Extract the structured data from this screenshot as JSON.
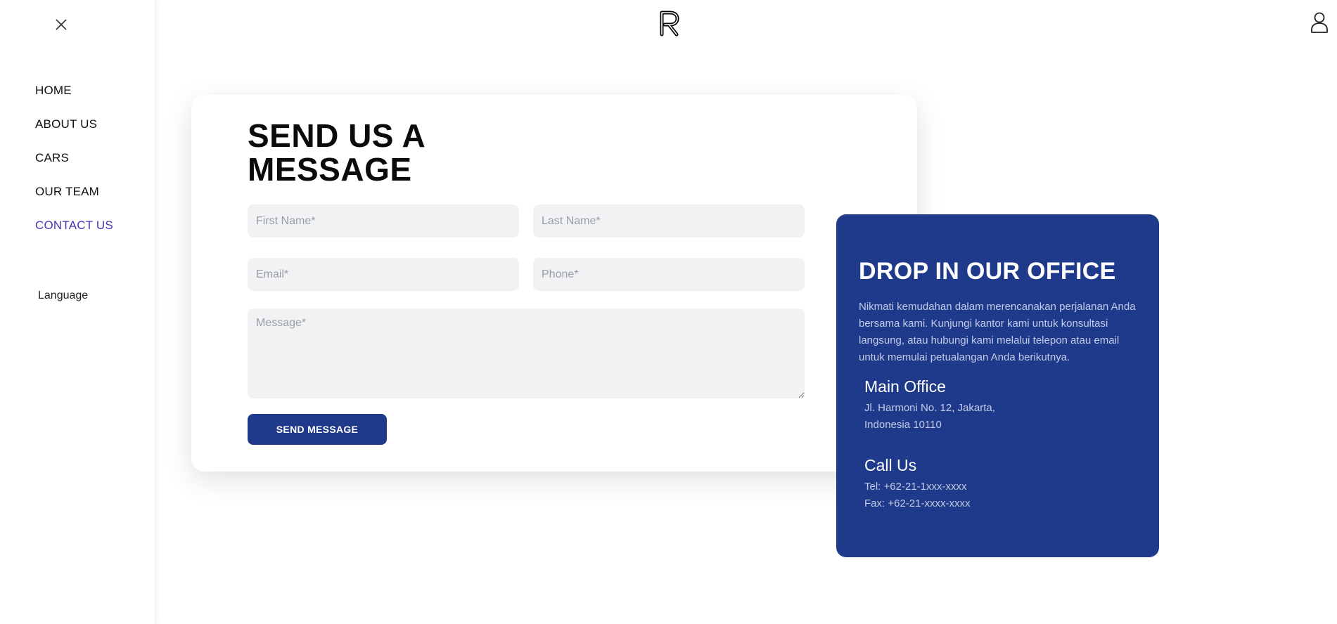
{
  "sidebar": {
    "nav": [
      {
        "label": "HOME"
      },
      {
        "label": "ABOUT US"
      },
      {
        "label": "CARS"
      },
      {
        "label": "OUR TEAM"
      },
      {
        "label": "CONTACT US",
        "active": true
      }
    ],
    "language_label": "Language"
  },
  "header": {
    "logo_icon": "r-logo-icon",
    "user_icon": "user-icon",
    "close_icon": "close-icon"
  },
  "form": {
    "title_line1": "SEND US A",
    "title_line2": "MESSAGE",
    "first_name_placeholder": "First Name*",
    "last_name_placeholder": "Last Name*",
    "email_placeholder": "Email*",
    "phone_placeholder": "Phone*",
    "message_placeholder": "Message*",
    "submit_label": "SEND MESSAGE"
  },
  "office": {
    "title": "DROP IN OUR OFFICE",
    "description": "Nikmati kemudahan dalam merencanakan perjalanan Anda bersama kami. Kunjungi kantor kami untuk konsultasi langsung, atau hubungi kami melalui telepon atau email untuk memulai petualangan Anda berikutnya.",
    "main_office_heading": "Main Office",
    "address_line1": "Jl. Harmoni No. 12, Jakarta,",
    "address_line2": "Indonesia 10110",
    "call_heading": "Call Us",
    "tel": "Tel: +62-21-1xxx-xxxx",
    "fax": "Fax: +62-21-xxxx-xxxx"
  },
  "colors": {
    "accent": "#1f3a8a",
    "active_nav": "#4b33b5",
    "field_bg": "#f1f2f4"
  }
}
